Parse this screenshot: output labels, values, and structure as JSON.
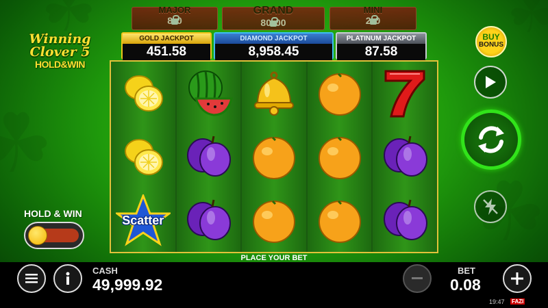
{
  "locked_jackpots": [
    {
      "title": "MAJOR",
      "value_left": "8",
      "value_right": "0"
    },
    {
      "title": "GRAND",
      "value_left": "80",
      "value_right": "00"
    },
    {
      "title": "MINI",
      "value_left": "2",
      "value_right": "0"
    }
  ],
  "jackpots": {
    "gold": {
      "title": "GOLD JACKPOT",
      "value": "451.58"
    },
    "diamond": {
      "title": "DIAMOND JACKPOT",
      "value": "8,958.45"
    },
    "platinum": {
      "title": "PLATINUM JACKPOT",
      "value": "87.58"
    }
  },
  "logo": {
    "line1": "Winning",
    "line2": "Clover 5",
    "line3": "HOLD&WIN"
  },
  "reels": [
    [
      "lemon",
      "lemon",
      "scatter-star"
    ],
    [
      "watermelon",
      "plum",
      "plum"
    ],
    [
      "bell",
      "orange",
      "orange"
    ],
    [
      "orange",
      "orange",
      "orange"
    ],
    [
      "seven",
      "plum",
      "plum"
    ]
  ],
  "scatter_text": "Scatter",
  "place_bet_text": "PLACE YOUR BET",
  "hold_win": {
    "label": "HOLD & WIN",
    "enabled": false
  },
  "buy_bonus": {
    "line1": "BUY",
    "line2": "BONUS"
  },
  "cash": {
    "label": "CASH",
    "value": "49,999.92"
  },
  "bet": {
    "label": "BET",
    "value": "0.08"
  },
  "status": {
    "time": "19:47",
    "brand": "FAZI"
  },
  "icons": {
    "menu": "hamburger-icon",
    "info": "info-icon",
    "minus": "minus-icon",
    "plus": "plus-icon",
    "play": "play-icon",
    "spin": "refresh-arrows-icon",
    "turbo": "lightning-off-icon"
  },
  "colors": {
    "reel_border": "#e3c23a",
    "spin_ring": "#31e31a",
    "gold": "#f0c419",
    "diamond": "#3dbdf0",
    "platinum": "#c8ccd2"
  }
}
